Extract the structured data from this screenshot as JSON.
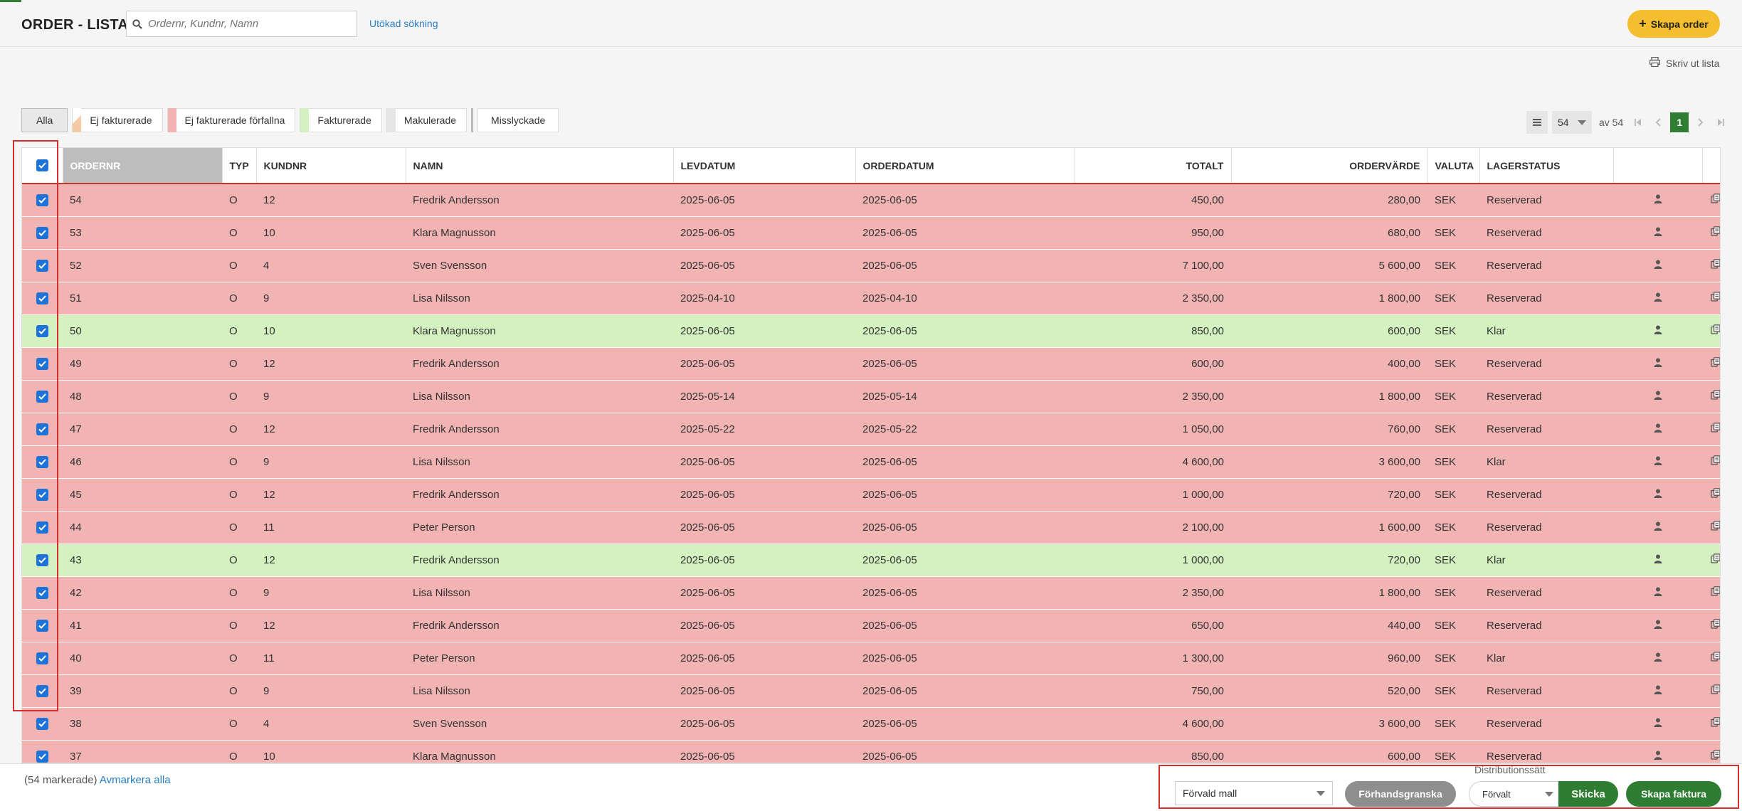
{
  "header": {
    "title": "ORDER - LISTA",
    "search_placeholder": "Ordernr, Kundnr, Namn",
    "advanced_search": "Utökad sökning",
    "create_order": "Skapa order",
    "print_list": "Skriv ut lista"
  },
  "filters": [
    {
      "label": "Alla",
      "color": ""
    },
    {
      "label": "Ej fakturerade",
      "color": "#f3c9a6"
    },
    {
      "label": "Ej fakturerade förfallna",
      "color": "#f2b3b3"
    },
    {
      "label": "Fakturerade",
      "color": "#d4f2c0"
    },
    {
      "label": "Makulerade",
      "color": "#e6e6e6"
    },
    {
      "label": "Misslyckade",
      "color": ""
    }
  ],
  "pager": {
    "page_size": "54",
    "of_text": "av 54",
    "current_page": "1"
  },
  "table": {
    "headers": {
      "ordernr": "ORDERNR",
      "typ": "TYP",
      "kundnr": "KUNDNR",
      "namn": "NAMN",
      "levdatum": "LEVDATUM",
      "orderdatum": "ORDERDATUM",
      "totalt": "TOTALT",
      "ordervarde": "ORDERVÄRDE",
      "valuta": "VALUTA",
      "lagerstatus": "LAGERSTATUS"
    },
    "rows": [
      {
        "ordernr": "54",
        "typ": "O",
        "kundnr": "12",
        "namn": "Fredrik Andersson",
        "levdatum": "2025-06-05",
        "orderdatum": "2025-06-05",
        "totalt": "450,00",
        "ordervarde": "280,00",
        "valuta": "SEK",
        "lagerstatus": "Reserverad",
        "status": "red"
      },
      {
        "ordernr": "53",
        "typ": "O",
        "kundnr": "10",
        "namn": "Klara Magnusson",
        "levdatum": "2025-06-05",
        "orderdatum": "2025-06-05",
        "totalt": "950,00",
        "ordervarde": "680,00",
        "valuta": "SEK",
        "lagerstatus": "Reserverad",
        "status": "red"
      },
      {
        "ordernr": "52",
        "typ": "O",
        "kundnr": "4",
        "namn": "Sven Svensson",
        "levdatum": "2025-06-05",
        "orderdatum": "2025-06-05",
        "totalt": "7 100,00",
        "ordervarde": "5 600,00",
        "valuta": "SEK",
        "lagerstatus": "Reserverad",
        "status": "red"
      },
      {
        "ordernr": "51",
        "typ": "O",
        "kundnr": "9",
        "namn": "Lisa Nilsson",
        "levdatum": "2025-04-10",
        "orderdatum": "2025-04-10",
        "totalt": "2 350,00",
        "ordervarde": "1 800,00",
        "valuta": "SEK",
        "lagerstatus": "Reserverad",
        "status": "red"
      },
      {
        "ordernr": "50",
        "typ": "O",
        "kundnr": "10",
        "namn": "Klara Magnusson",
        "levdatum": "2025-06-05",
        "orderdatum": "2025-06-05",
        "totalt": "850,00",
        "ordervarde": "600,00",
        "valuta": "SEK",
        "lagerstatus": "Klar",
        "status": "green"
      },
      {
        "ordernr": "49",
        "typ": "O",
        "kundnr": "12",
        "namn": "Fredrik Andersson",
        "levdatum": "2025-06-05",
        "orderdatum": "2025-06-05",
        "totalt": "600,00",
        "ordervarde": "400,00",
        "valuta": "SEK",
        "lagerstatus": "Reserverad",
        "status": "red"
      },
      {
        "ordernr": "48",
        "typ": "O",
        "kundnr": "9",
        "namn": "Lisa Nilsson",
        "levdatum": "2025-05-14",
        "orderdatum": "2025-05-14",
        "totalt": "2 350,00",
        "ordervarde": "1 800,00",
        "valuta": "SEK",
        "lagerstatus": "Reserverad",
        "status": "red"
      },
      {
        "ordernr": "47",
        "typ": "O",
        "kundnr": "12",
        "namn": "Fredrik Andersson",
        "levdatum": "2025-05-22",
        "orderdatum": "2025-05-22",
        "totalt": "1 050,00",
        "ordervarde": "760,00",
        "valuta": "SEK",
        "lagerstatus": "Reserverad",
        "status": "red"
      },
      {
        "ordernr": "46",
        "typ": "O",
        "kundnr": "9",
        "namn": "Lisa Nilsson",
        "levdatum": "2025-06-05",
        "orderdatum": "2025-06-05",
        "totalt": "4 600,00",
        "ordervarde": "3 600,00",
        "valuta": "SEK",
        "lagerstatus": "Klar",
        "status": "red"
      },
      {
        "ordernr": "45",
        "typ": "O",
        "kundnr": "12",
        "namn": "Fredrik Andersson",
        "levdatum": "2025-06-05",
        "orderdatum": "2025-06-05",
        "totalt": "1 000,00",
        "ordervarde": "720,00",
        "valuta": "SEK",
        "lagerstatus": "Reserverad",
        "status": "red"
      },
      {
        "ordernr": "44",
        "typ": "O",
        "kundnr": "11",
        "namn": "Peter Person",
        "levdatum": "2025-06-05",
        "orderdatum": "2025-06-05",
        "totalt": "2 100,00",
        "ordervarde": "1 600,00",
        "valuta": "SEK",
        "lagerstatus": "Reserverad",
        "status": "red"
      },
      {
        "ordernr": "43",
        "typ": "O",
        "kundnr": "12",
        "namn": "Fredrik Andersson",
        "levdatum": "2025-06-05",
        "orderdatum": "2025-06-05",
        "totalt": "1 000,00",
        "ordervarde": "720,00",
        "valuta": "SEK",
        "lagerstatus": "Klar",
        "status": "green"
      },
      {
        "ordernr": "42",
        "typ": "O",
        "kundnr": "9",
        "namn": "Lisa Nilsson",
        "levdatum": "2025-06-05",
        "orderdatum": "2025-06-05",
        "totalt": "2 350,00",
        "ordervarde": "1 800,00",
        "valuta": "SEK",
        "lagerstatus": "Reserverad",
        "status": "red"
      },
      {
        "ordernr": "41",
        "typ": "O",
        "kundnr": "12",
        "namn": "Fredrik Andersson",
        "levdatum": "2025-06-05",
        "orderdatum": "2025-06-05",
        "totalt": "650,00",
        "ordervarde": "440,00",
        "valuta": "SEK",
        "lagerstatus": "Reserverad",
        "status": "red"
      },
      {
        "ordernr": "40",
        "typ": "O",
        "kundnr": "11",
        "namn": "Peter Person",
        "levdatum": "2025-06-05",
        "orderdatum": "2025-06-05",
        "totalt": "1 300,00",
        "ordervarde": "960,00",
        "valuta": "SEK",
        "lagerstatus": "Klar",
        "status": "red"
      },
      {
        "ordernr": "39",
        "typ": "O",
        "kundnr": "9",
        "namn": "Lisa Nilsson",
        "levdatum": "2025-06-05",
        "orderdatum": "2025-06-05",
        "totalt": "750,00",
        "ordervarde": "520,00",
        "valuta": "SEK",
        "lagerstatus": "Reserverad",
        "status": "red"
      },
      {
        "ordernr": "38",
        "typ": "O",
        "kundnr": "4",
        "namn": "Sven Svensson",
        "levdatum": "2025-06-05",
        "orderdatum": "2025-06-05",
        "totalt": "4 600,00",
        "ordervarde": "3 600,00",
        "valuta": "SEK",
        "lagerstatus": "Reserverad",
        "status": "red"
      },
      {
        "ordernr": "37",
        "typ": "O",
        "kundnr": "10",
        "namn": "Klara Magnusson",
        "levdatum": "2025-06-05",
        "orderdatum": "2025-06-05",
        "totalt": "850,00",
        "ordervarde": "600,00",
        "valuta": "SEK",
        "lagerstatus": "Reserverad",
        "status": "red"
      }
    ]
  },
  "footer": {
    "selected_count": "(54 markerade)",
    "deselect_all": "Avmarkera alla",
    "template": "Förvald mall",
    "preview": "Förhandsgranska",
    "distribution_label": "Distributionssätt",
    "distribution_value": "Förvalt",
    "send": "Skicka",
    "create_invoice": "Skapa faktura"
  },
  "colors": {
    "row_unpaid_overdue": "#f2b3b3",
    "row_invoiced": "#d4f2c0",
    "accent_green": "#2e7d32",
    "create_button": "#f5be2e",
    "checkbox": "#1e73d8",
    "highlight": "#d32f2f"
  },
  "icons": {
    "search": "search-icon",
    "plus": "plus-icon",
    "print": "printer-icon",
    "menu": "menu-icon",
    "user": "user-icon",
    "copy": "copy-icon"
  }
}
